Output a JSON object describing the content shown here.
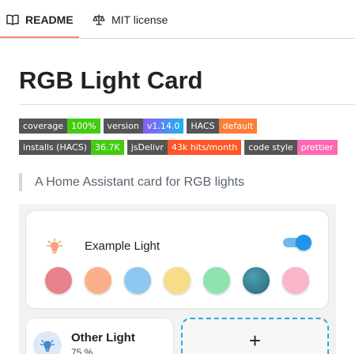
{
  "tabs": {
    "readme": "README",
    "license": "MIT license",
    "active": "readme"
  },
  "title": "RGB Light Card",
  "badges": {
    "row1": [
      {
        "key": "coverage",
        "value": "100%",
        "color": "#4c1"
      },
      {
        "key": "version",
        "value": "v1.14.0",
        "color": ""
      },
      {
        "key": "HACS",
        "value": "default",
        "color": "#fe7d37"
      }
    ],
    "row2": [
      {
        "key": "installs (HACS)",
        "value": "36.7K",
        "color": "#44cc11"
      },
      {
        "key": "jsDelivr",
        "value": "43k hits/month",
        "color": "#ff5627"
      },
      {
        "key": "code style",
        "value": "prettier",
        "color": "#ff69b4"
      }
    ]
  },
  "description": "A Home Assistant card for RGB lights",
  "preview": {
    "card1": {
      "name": "Example Light",
      "toggle_on": true,
      "accent": "#1f95ea",
      "swatches": [
        "#e8828a",
        "#fbb08b",
        "#8cc8ef",
        "#f7dc8a",
        "#8fe3b0",
        "#2f7f93",
        "#fbb5c8"
      ]
    },
    "card2": {
      "name": "Other Light",
      "brightness": "75 %"
    },
    "add_label": "+"
  }
}
